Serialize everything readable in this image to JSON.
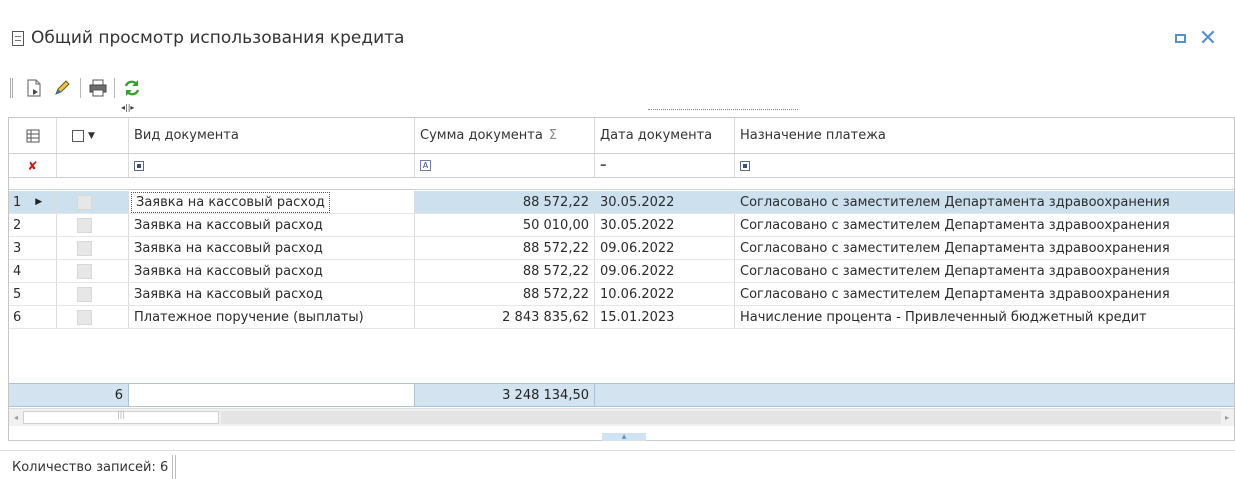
{
  "window": {
    "title": "Общий просмотр использования кредита"
  },
  "grid": {
    "columns": {
      "vid": "Вид документа",
      "sum": "Сумма документа",
      "sum_icon": "Σ",
      "date": "Дата документа",
      "purpose": "Назначение платежа"
    },
    "filter": {
      "date_op": "–"
    },
    "rows": [
      {
        "num": "1",
        "vid": "Заявка на кассовый расход",
        "sum": "88 572,22",
        "date": "30.05.2022",
        "purpose": "Согласовано с заместителем Департамента здравоохранения"
      },
      {
        "num": "2",
        "vid": "Заявка на кассовый расход",
        "sum": "50 010,00",
        "date": "30.05.2022",
        "purpose": "Согласовано с заместителем Департамента здравоохранения"
      },
      {
        "num": "3",
        "vid": "Заявка на кассовый расход",
        "sum": "88 572,22",
        "date": "09.06.2022",
        "purpose": "Согласовано с заместителем Департамента здравоохранения"
      },
      {
        "num": "4",
        "vid": "Заявка на кассовый расход",
        "sum": "88 572,22",
        "date": "09.06.2022",
        "purpose": "Согласовано с заместителем Департамента здравоохранения"
      },
      {
        "num": "5",
        "vid": "Заявка на кассовый расход",
        "sum": "88 572,22",
        "date": "10.06.2022",
        "purpose": "Согласовано с заместителем Департамента здравоохранения"
      },
      {
        "num": "6",
        "vid": "Платежное поручение (выплаты)",
        "sum": "2 843 835,62",
        "date": "15.01.2023",
        "purpose": "Начисление процента - Привлеченный бюджетный кредит"
      }
    ],
    "totals": {
      "count": "6",
      "sum": "3 248 134,50"
    }
  },
  "status": {
    "records": "Количество записей: 6"
  },
  "colors": {
    "sum_text": "#3a8a1f",
    "selected_row": "#cde0ee",
    "total_row": "#d3e3f0",
    "accent": "#5b8fc7"
  },
  "icons": {
    "title": "document-icon",
    "toolbar": [
      "new-document-icon",
      "edit-pencil-icon",
      "print-icon",
      "refresh-icon"
    ]
  }
}
